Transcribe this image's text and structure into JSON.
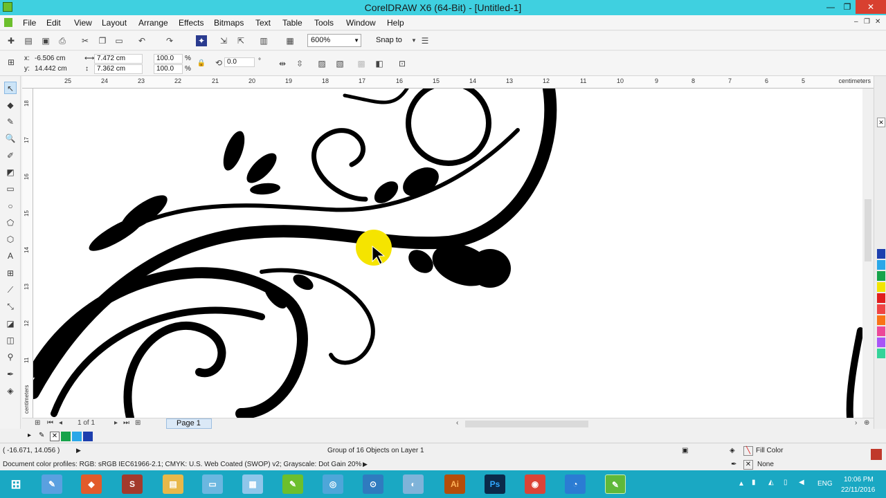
{
  "window": {
    "title": "CorelDRAW X6 (64-Bit) - [Untitled-1]",
    "min": "—",
    "restore": "❐",
    "close": "✕"
  },
  "menu": {
    "items": [
      "File",
      "Edit",
      "View",
      "Layout",
      "Arrange",
      "Effects",
      "Bitmaps",
      "Text",
      "Table",
      "Tools",
      "Window",
      "Help"
    ],
    "mdi_min": "–",
    "mdi_restore": "❐",
    "mdi_close": "✕"
  },
  "toolbar": {
    "zoom": "600%",
    "snap_to": "Snap to"
  },
  "propbar": {
    "x_label": "x:",
    "x_value": "-6.506 cm",
    "y_label": "y:",
    "y_value": "14.442 cm",
    "width": "7.472 cm",
    "height": "7.362 cm",
    "scale_x": "100.0",
    "scale_y": "100.0",
    "pct1": "%",
    "pct2": "%",
    "rotation": "0.0",
    "degree": "°"
  },
  "ruler": {
    "h_ticks": [
      "25",
      "24",
      "23",
      "22",
      "21",
      "20",
      "19",
      "18",
      "17",
      "16",
      "15",
      "14",
      "13",
      "12",
      "11",
      "10",
      "9",
      "8",
      "7",
      "6",
      "5"
    ],
    "units": "centimeters",
    "v_ticks": [
      "18",
      "17",
      "16",
      "15",
      "14",
      "13",
      "12",
      "11"
    ],
    "v_units": "centimeters"
  },
  "pagenav": {
    "page_count": "1 of 1",
    "page_tab": "Page 1"
  },
  "status": {
    "coords": "( -16.671, 14.056 )",
    "selection": "Group of 16 Objects on Layer 1",
    "fill_label": "Fill Color",
    "outline_label": "None",
    "profiles": "Document color profiles: RGB: sRGB IEC61966-2.1; CMYK: U.S. Web Coated (SWOP) v2; Grayscale: Dot Gain 20%"
  },
  "taskbar": {
    "lang": "ENG",
    "time": "10:06 PM",
    "date": "22/11/2016",
    "apps": [
      "S",
      "Ai",
      "Ps"
    ]
  },
  "colors": {
    "titlebar": "#3fd0e0",
    "taskbar": "#1aa8c3",
    "cursor_highlight": "#f5e400",
    "palette": [
      "#1d3fae",
      "#2aa7e8",
      "#16a34a",
      "#f2e500",
      "#e11d1d",
      "#ef4444",
      "#f97316",
      "#ec4899",
      "#a855f7",
      "#34d399"
    ]
  }
}
